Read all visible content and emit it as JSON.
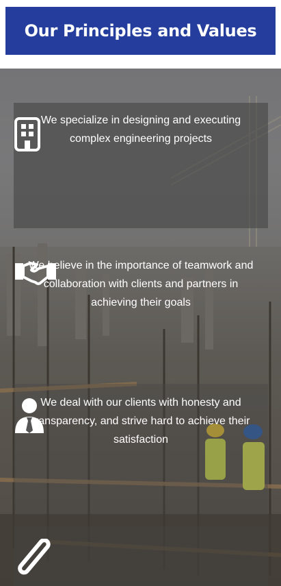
{
  "header": {
    "title": "Our Principles and Values"
  },
  "principles": [
    {
      "icon": "building-icon",
      "text": "We specialize in designing and executing complex engineering projects"
    },
    {
      "icon": "handshake-icon",
      "text": "We believe in the importance of teamwork and collaboration with clients and partners in achieving their goals"
    },
    {
      "icon": "user-tie-icon",
      "text": "We deal with our clients with honesty and transparency, and strive hard to achieve their satisfaction"
    },
    {
      "icon": "ruler-icon",
      "text": ""
    }
  ]
}
